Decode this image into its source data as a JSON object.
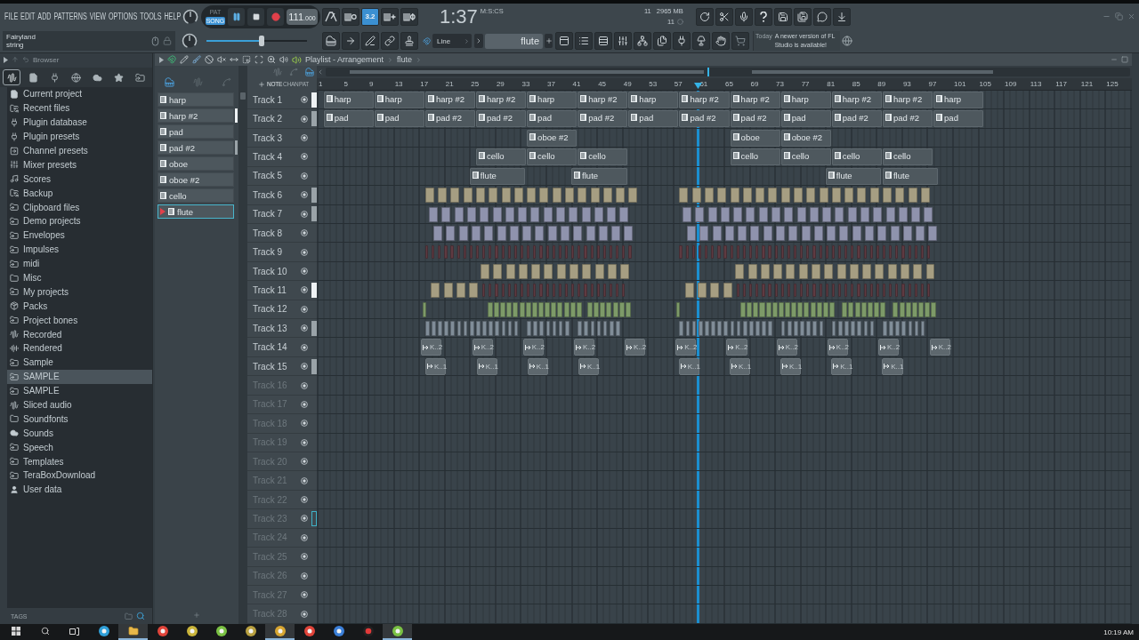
{
  "menu": [
    "FILE",
    "EDIT",
    "ADD",
    "PATTERNS",
    "VIEW",
    "OPTIONS",
    "TOOLS",
    "HELP"
  ],
  "hint": {
    "title": "Fairyland",
    "subtitle": "string"
  },
  "transport": {
    "modes": [
      {
        "label": "PAT",
        "selected": false
      },
      {
        "label": "SONG",
        "selected": true
      }
    ],
    "playing": true,
    "tempo": "111",
    "tempo_decimals": ".000"
  },
  "countdown": {
    "label": "3.2",
    "on": true
  },
  "clock": {
    "time": "1:37",
    "unit": "M:S:CS"
  },
  "monitor": {
    "cpu": "11",
    "memory": "2965 MB",
    "polyphony": "11"
  },
  "song_position": {
    "level": 0.55
  },
  "snap": {
    "value": "Line"
  },
  "pattern_selector": {
    "value": "flute"
  },
  "news": {
    "date": "Today",
    "text": "A newer version of FL Studio is available!"
  },
  "browser": {
    "title": "Browser",
    "tabs": [
      {
        "kind": "all",
        "selected": true
      },
      {
        "kind": "project",
        "selected": false
      },
      {
        "kind": "plugin",
        "selected": false
      },
      {
        "kind": "globe",
        "selected": false
      },
      {
        "kind": "cloud",
        "selected": false
      },
      {
        "kind": "star",
        "selected": false
      },
      {
        "kind": "folder",
        "selected": false
      }
    ],
    "items": [
      {
        "label": "Current project",
        "kind": "file",
        "selected": false
      },
      {
        "label": "Recent files",
        "kind": "folder-sync",
        "selected": false
      },
      {
        "label": "Plugin database",
        "kind": "plug",
        "selected": false
      },
      {
        "label": "Plugin presets",
        "kind": "plug",
        "selected": false
      },
      {
        "label": "Channel presets",
        "kind": "channel",
        "selected": false
      },
      {
        "label": "Mixer presets",
        "kind": "mixer",
        "selected": false
      },
      {
        "label": "Scores",
        "kind": "note",
        "selected": false
      },
      {
        "label": "Backup",
        "kind": "folder-sync",
        "selected": false
      },
      {
        "label": "Clipboard files",
        "kind": "folder-link",
        "selected": false
      },
      {
        "label": "Demo projects",
        "kind": "folder-link",
        "selected": false
      },
      {
        "label": "Envelopes",
        "kind": "folder-link",
        "selected": false
      },
      {
        "label": "Impulses",
        "kind": "folder-link",
        "selected": false
      },
      {
        "label": "midi",
        "kind": "folder-link",
        "selected": false
      },
      {
        "label": "Misc",
        "kind": "folder",
        "selected": false
      },
      {
        "label": "My projects",
        "kind": "folder-link",
        "selected": false
      },
      {
        "label": "Packs",
        "kind": "package",
        "selected": false
      },
      {
        "label": "Project bones",
        "kind": "folder-link",
        "selected": false
      },
      {
        "label": "Recorded",
        "kind": "waveform",
        "selected": false
      },
      {
        "label": "Rendered",
        "kind": "render",
        "selected": false
      },
      {
        "label": "Sample",
        "kind": "folder-link",
        "selected": false
      },
      {
        "label": "SAMPLE",
        "kind": "folder-link",
        "selected": true
      },
      {
        "label": "SAMPLE",
        "kind": "folder-link",
        "selected": false
      },
      {
        "label": "Sliced audio",
        "kind": "waveform",
        "selected": false
      },
      {
        "label": "Soundfonts",
        "kind": "folder",
        "selected": false
      },
      {
        "label": "Sounds",
        "kind": "cloud",
        "selected": false
      },
      {
        "label": "Speech",
        "kind": "folder-link",
        "selected": false
      },
      {
        "label": "Templates",
        "kind": "folder-link",
        "selected": false
      },
      {
        "label": "TeraBoxDownload",
        "kind": "folder-link",
        "selected": false
      },
      {
        "label": "User data",
        "kind": "user",
        "selected": false
      }
    ],
    "footer": "TAGS"
  },
  "playlist": {
    "breadcrumb": [
      "Playlist - Arrangement",
      "flute"
    ],
    "sources": [
      {
        "label": "NOTE",
        "selected": true
      },
      {
        "label": "CHAN",
        "selected": false
      },
      {
        "label": "PAT",
        "selected": false
      }
    ],
    "patterns": [
      {
        "label": "harp",
        "selected": false
      },
      {
        "label": "harp #2",
        "selected": false,
        "meter": {
          "lit": true
        }
      },
      {
        "label": "pad",
        "selected": false
      },
      {
        "label": "pad #2",
        "selected": false,
        "meter": {
          "lit": false
        }
      },
      {
        "label": "oboe",
        "selected": false
      },
      {
        "label": "oboe #2",
        "selected": false
      },
      {
        "label": "cello",
        "selected": false
      },
      {
        "label": "flute",
        "selected": true
      }
    ],
    "ruler": [
      "1",
      "5",
      "9",
      "13",
      "17",
      "21",
      "25",
      "29",
      "33",
      "37",
      "41",
      "45",
      "49",
      "53",
      "57",
      "61",
      "65",
      "69",
      "73",
      "77",
      "81",
      "85",
      "89",
      "93",
      "97",
      "101",
      "105",
      "109",
      "113",
      "117",
      "121",
      "125"
    ],
    "tracks": [
      {
        "name": "Track 1",
        "empty": false,
        "focused": false,
        "meter": {
          "lit": true
        },
        "clips": [
          {
            "label": "harp",
            "kind": "pattern"
          },
          {
            "label": "harp",
            "kind": "pattern"
          },
          {
            "label": "harp #2",
            "kind": "pattern"
          },
          {
            "label": "harp #2",
            "kind": "pattern"
          },
          {
            "label": "harp",
            "kind": "pattern"
          },
          {
            "label": "harp #2",
            "kind": "pattern"
          },
          {
            "label": "harp",
            "kind": "pattern"
          },
          {
            "label": "harp #2",
            "kind": "pattern"
          },
          {
            "label": "harp #2",
            "kind": "pattern"
          },
          {
            "label": "harp",
            "kind": "pattern"
          },
          {
            "label": "harp #2",
            "kind": "pattern"
          },
          {
            "label": "harp #2",
            "kind": "pattern"
          },
          {
            "label": "harp",
            "kind": "pattern"
          }
        ]
      },
      {
        "name": "Track 2",
        "empty": false,
        "focused": false,
        "meter": {
          "lit": false
        },
        "clips": [
          {
            "label": "pad",
            "kind": "pattern"
          },
          {
            "label": "pad",
            "kind": "pattern"
          },
          {
            "label": "pad #2",
            "kind": "pattern"
          },
          {
            "label": "pad #2",
            "kind": "pattern"
          },
          {
            "label": "pad",
            "kind": "pattern"
          },
          {
            "label": "pad #2",
            "kind": "pattern"
          },
          {
            "label": "pad",
            "kind": "pattern"
          },
          {
            "label": "pad #2",
            "kind": "pattern"
          },
          {
            "label": "pad #2",
            "kind": "pattern"
          },
          {
            "label": "pad",
            "kind": "pattern"
          },
          {
            "label": "pad #2",
            "kind": "pattern"
          },
          {
            "label": "pad #2",
            "kind": "pattern"
          },
          {
            "label": "pad",
            "kind": "pattern"
          }
        ]
      },
      {
        "name": "Track 3",
        "empty": false,
        "focused": false,
        "clips": [
          {
            "label": "oboe #2",
            "kind": "pattern"
          },
          {
            "label": "oboe",
            "kind": "pattern"
          },
          {
            "label": "oboe #2",
            "kind": "pattern"
          }
        ]
      },
      {
        "name": "Track 4",
        "empty": false,
        "focused": false,
        "clips": [
          {
            "label": "cello",
            "kind": "pattern"
          },
          {
            "label": "cello",
            "kind": "pattern"
          },
          {
            "label": "cello",
            "kind": "pattern"
          },
          {
            "label": "cello",
            "kind": "pattern"
          },
          {
            "label": "cello",
            "kind": "pattern"
          },
          {
            "label": "cello",
            "kind": "pattern"
          },
          {
            "label": "cello",
            "kind": "pattern"
          }
        ]
      },
      {
        "name": "Track 5",
        "empty": false,
        "focused": false,
        "clips": [
          {
            "label": "flute",
            "kind": "pattern"
          },
          {
            "label": "flute",
            "kind": "pattern"
          },
          {
            "label": "flute",
            "kind": "pattern"
          },
          {
            "label": "flute",
            "kind": "pattern"
          }
        ]
      },
      {
        "name": "Track 6",
        "empty": false,
        "focused": false,
        "meter": {
          "lit": false
        }
      },
      {
        "name": "Track 7",
        "empty": false,
        "focused": false,
        "meter": {
          "lit": false
        }
      },
      {
        "name": "Track 8",
        "empty": false,
        "focused": false
      },
      {
        "name": "Track 9",
        "empty": false,
        "focused": false
      },
      {
        "name": "Track 10",
        "empty": false,
        "focused": false
      },
      {
        "name": "Track 11",
        "empty": false,
        "focused": false,
        "meter": {
          "lit": true
        }
      },
      {
        "name": "Track 12",
        "empty": false,
        "focused": false
      },
      {
        "name": "Track 13",
        "empty": false,
        "focused": false,
        "meter": {
          "lit": false
        }
      },
      {
        "name": "Track 14",
        "empty": false,
        "focused": false,
        "clips": [
          {
            "label": "K..2",
            "kind": "audio"
          },
          {
            "label": "K..2",
            "kind": "audio"
          },
          {
            "label": "K..2",
            "kind": "audio"
          },
          {
            "label": "K..2",
            "kind": "audio"
          },
          {
            "label": "K..2",
            "kind": "audio"
          },
          {
            "label": "K..2",
            "kind": "audio"
          },
          {
            "label": "K..2",
            "kind": "audio"
          },
          {
            "label": "K..2",
            "kind": "audio"
          },
          {
            "label": "K..2",
            "kind": "audio"
          },
          {
            "label": "K..2",
            "kind": "audio"
          },
          {
            "label": "K..2",
            "kind": "audio"
          }
        ]
      },
      {
        "name": "Track 15",
        "empty": false,
        "focused": false,
        "meter": {
          "lit": false
        },
        "clips": [
          {
            "label": "K..1",
            "kind": "audio"
          },
          {
            "label": "K..1",
            "kind": "audio"
          },
          {
            "label": "K..1",
            "kind": "audio"
          },
          {
            "label": "K..1",
            "kind": "audio"
          },
          {
            "label": "K..1",
            "kind": "audio"
          },
          {
            "label": "K..1",
            "kind": "audio"
          },
          {
            "label": "K..1",
            "kind": "audio"
          },
          {
            "label": "K..1",
            "kind": "audio"
          },
          {
            "label": "K..1",
            "kind": "audio"
          }
        ]
      },
      {
        "name": "Track 16",
        "empty": true,
        "focused": false
      },
      {
        "name": "Track 17",
        "empty": true,
        "focused": false
      },
      {
        "name": "Track 18",
        "empty": true,
        "focused": false
      },
      {
        "name": "Track 19",
        "empty": true,
        "focused": false
      },
      {
        "name": "Track 20",
        "empty": true,
        "focused": false
      },
      {
        "name": "Track 21",
        "empty": true,
        "focused": false
      },
      {
        "name": "Track 22",
        "empty": true,
        "focused": false
      },
      {
        "name": "Track 23",
        "empty": true,
        "focused": true
      },
      {
        "name": "Track 24",
        "empty": true,
        "focused": false
      },
      {
        "name": "Track 25",
        "empty": true,
        "focused": false
      },
      {
        "name": "Track 26",
        "empty": true,
        "focused": false
      },
      {
        "name": "Track 27",
        "empty": true,
        "focused": false
      },
      {
        "name": "Track 28",
        "empty": true,
        "focused": false
      }
    ]
  },
  "taskbar": {
    "apps": [
      {
        "kind": "start",
        "active": false
      },
      {
        "kind": "search",
        "active": false
      },
      {
        "kind": "taskview",
        "active": false
      },
      {
        "kind": "app",
        "color": "#2f9fd8",
        "active": false
      },
      {
        "kind": "folder",
        "active": true
      },
      {
        "kind": "app",
        "color": "#e0443a",
        "active": false
      },
      {
        "kind": "app",
        "color": "#c9b43a",
        "active": false
      },
      {
        "kind": "app",
        "color": "#7ac143",
        "active": false
      },
      {
        "kind": "app",
        "color": "#b8a040",
        "active": false
      },
      {
        "kind": "app",
        "color": "#d6a531",
        "active": true
      },
      {
        "kind": "app",
        "color": "#e0443a",
        "active": false
      },
      {
        "kind": "app",
        "color": "#3b7fd8",
        "active": false
      },
      {
        "kind": "record",
        "active": false
      },
      {
        "kind": "app",
        "color": "#7ac143",
        "active": true
      }
    ],
    "time": "10:19 AM"
  }
}
